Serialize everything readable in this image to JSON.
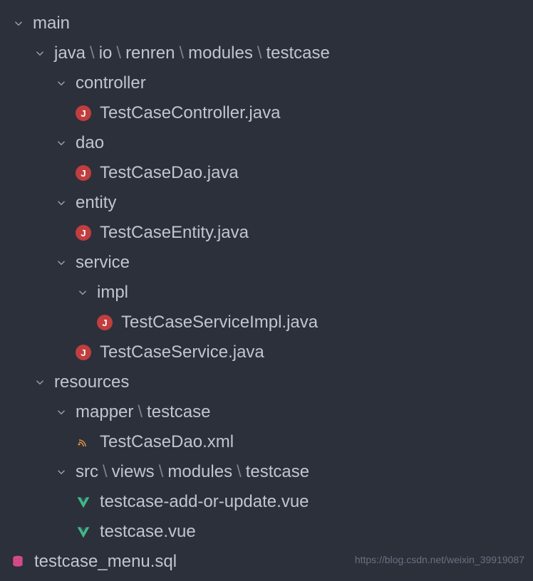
{
  "tree": {
    "main": "main",
    "java_path": [
      "java",
      "io",
      "renren",
      "modules",
      "testcase"
    ],
    "controller": "controller",
    "controller_file": "TestCaseController.java",
    "dao": "dao",
    "dao_file": "TestCaseDao.java",
    "entity": "entity",
    "entity_file": "TestCaseEntity.java",
    "service": "service",
    "impl": "impl",
    "service_impl_file": "TestCaseServiceImpl.java",
    "service_file": "TestCaseService.java",
    "resources": "resources",
    "mapper_path": [
      "mapper",
      "testcase"
    ],
    "mapper_file": "TestCaseDao.xml",
    "views_path": [
      "src",
      "views",
      "modules",
      "testcase"
    ],
    "vue_file_1": "testcase-add-or-update.vue",
    "vue_file_2": "testcase.vue",
    "sql_file": "testcase_menu.sql"
  },
  "icons": {
    "java_letter": "J"
  },
  "watermark": "https://blog.csdn.net/weixin_39919087"
}
